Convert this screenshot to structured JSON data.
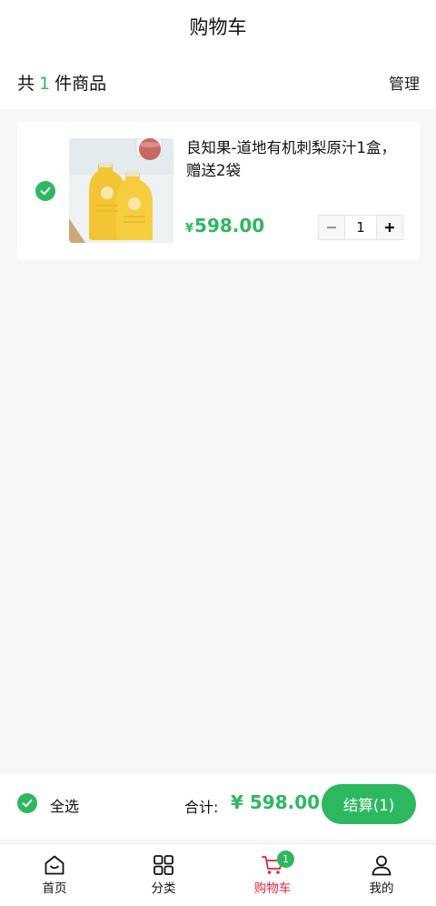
{
  "header": {
    "title": "购物车",
    "count_prefix": "共",
    "count_value": "1",
    "count_suffix": "件商品",
    "manage_label": "管理"
  },
  "cart": {
    "items": [
      {
        "name": "良知果-道地有机刺梨原汁1盒，赠送2袋",
        "price_symbol": "¥",
        "price": "598.00",
        "quantity": "1",
        "selected": true,
        "thumbnail_icon": "juice-pouch-image"
      }
    ]
  },
  "checkout": {
    "select_all_label": "全选",
    "total_label": "合计:",
    "total_value": "¥ 598.00",
    "button_label": "结算(1)"
  },
  "tabbar": {
    "items": [
      {
        "label": "首页",
        "icon": "home-icon",
        "active": false
      },
      {
        "label": "分类",
        "icon": "grid-icon",
        "active": false
      },
      {
        "label": "购物车",
        "icon": "cart-icon",
        "active": true,
        "badge": "1"
      },
      {
        "label": "我的",
        "icon": "user-icon",
        "active": false
      }
    ]
  },
  "colors": {
    "accent": "#2db860",
    "active_tab": "#e2233a",
    "background": "#f7f7f7"
  }
}
